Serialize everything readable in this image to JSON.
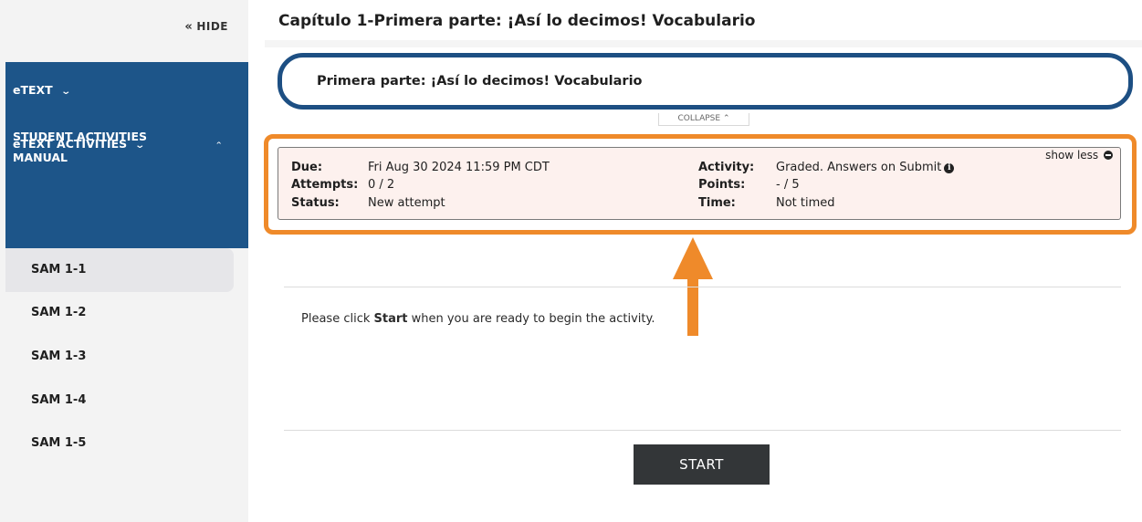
{
  "sidebar": {
    "hide_label": "HIDE",
    "hide_icon": "double-chevron-left-icon",
    "nav": {
      "etext_label": "eTEXT",
      "etext_activities_label": "eTEXT ACTIVITIES",
      "sam_label_line1": "STUDENT ACTIVITIES",
      "sam_label_line2": "MANUAL"
    },
    "sam_items": [
      "SAM 1-1",
      "SAM 1-2",
      "SAM 1-3",
      "SAM 1-4",
      "SAM 1-5"
    ],
    "active_item": "SAM 1-1"
  },
  "main": {
    "page_title": "Capítulo 1-Primera parte: ¡Así lo decimos! Vocabulario",
    "card_title": "Primera parte: ¡Así lo decimos! Vocabulario",
    "collapse_label": "COLLAPSE",
    "info": {
      "show_less_label": "show less",
      "due_label": "Due:",
      "due_value": "Fri Aug 30 2024 11:59 PM CDT",
      "attempts_label": "Attempts:",
      "attempts_value": "0 / 2",
      "status_label": "Status:",
      "status_value": "New attempt",
      "activity_label": "Activity:",
      "activity_value": "Graded. Answers on Submit",
      "points_label": "Points:",
      "points_value": "- / 5",
      "time_label": "Time:",
      "time_value": "Not timed"
    },
    "instructions_pre": "Please click ",
    "instructions_bold": "Start",
    "instructions_post": " when you are ready to begin the activity.",
    "start_label": "START"
  },
  "colors": {
    "nav_blue": "#1d5589",
    "card_border": "#1d4f83",
    "highlight_orange": "#ef8a2a",
    "info_bg": "#fdf1ee",
    "start_bg": "#333638"
  }
}
